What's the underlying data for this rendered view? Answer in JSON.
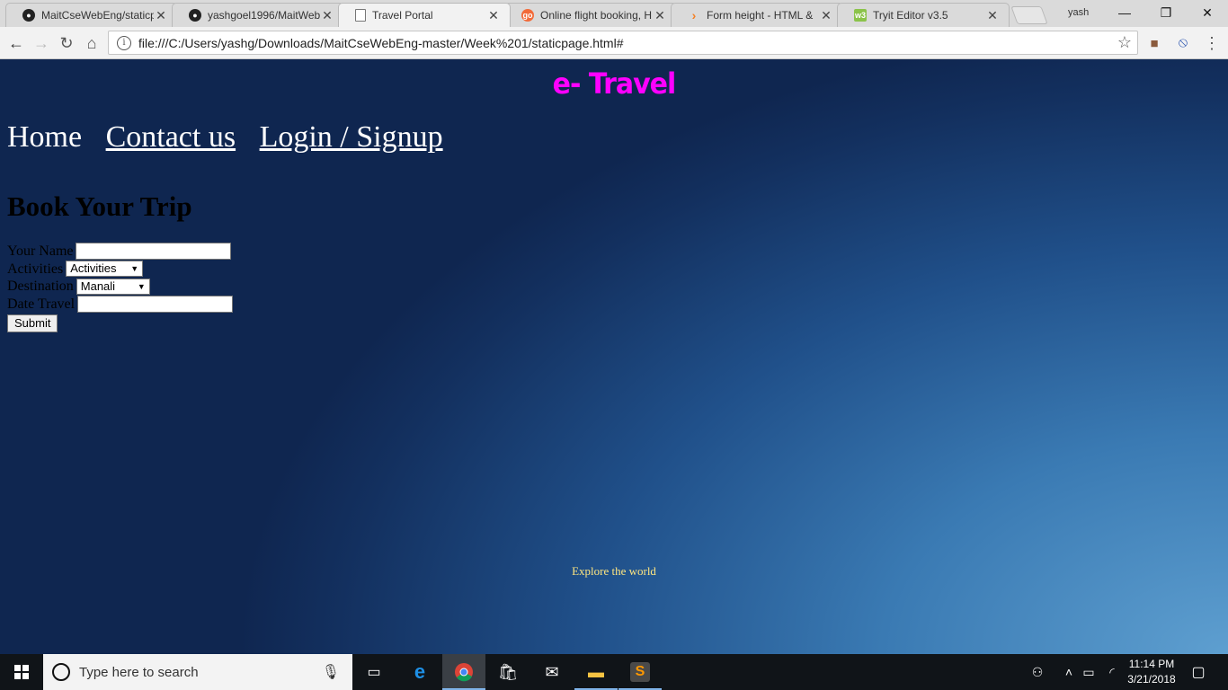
{
  "browser": {
    "tabs": [
      {
        "title": "MaitCseWebEng/staticp",
        "favicon": "github-icon"
      },
      {
        "title": "yashgoel1996/MaitWeb",
        "favicon": "github-icon"
      },
      {
        "title": "Travel Portal",
        "favicon": "page-icon",
        "active": true
      },
      {
        "title": "Online flight booking, H",
        "favicon": "goibibo-icon"
      },
      {
        "title": "Form height - HTML &",
        "favicon": "code-icon"
      },
      {
        "title": "Tryit Editor v3.5",
        "favicon": "w3schools-icon"
      }
    ],
    "profile": "yash",
    "url": "file:///C:/Users/yashg/Downloads/MaitCseWebEng-master/Week%201/staticpage.html#"
  },
  "page": {
    "brand": "e- Travel",
    "nav": {
      "home": "Home",
      "contact": "Contact us",
      "login": "Login / Signup"
    },
    "heading": "Book Your Trip",
    "form": {
      "name_label": "Your Name",
      "name_value": "",
      "activities_label": "Activities",
      "activities_selected": "Activities",
      "destination_label": "Destination",
      "destination_selected": "Manali",
      "date_label": "Date Travel",
      "date_value": "",
      "submit_label": "Submit"
    },
    "footer": "Explore the world",
    "colors": {
      "brand": "#ff00ff",
      "footer": "#ffe680"
    }
  },
  "taskbar": {
    "search_placeholder": "Type here to search",
    "time": "11:14 PM",
    "date": "3/21/2018"
  }
}
